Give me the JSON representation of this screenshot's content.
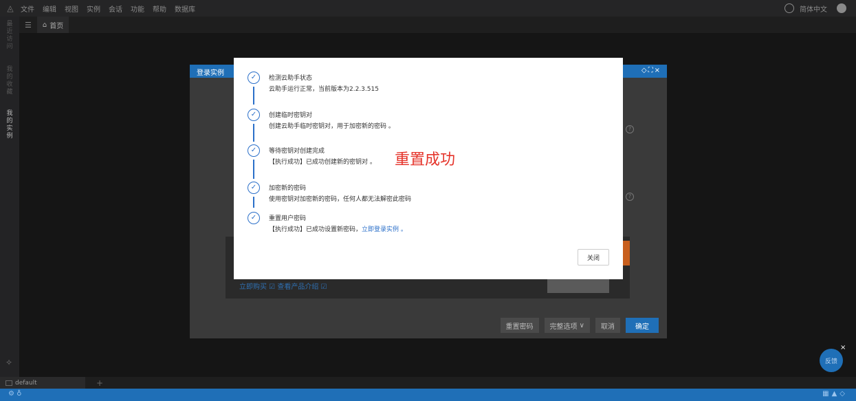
{
  "menubar": {
    "items": [
      "文件",
      "编辑",
      "视图",
      "实例",
      "会话",
      "功能",
      "帮助",
      "数据库"
    ],
    "language": "简体中文"
  },
  "sidebar": {
    "groups": [
      "最近访问",
      "我的收藏",
      "我的实例"
    ]
  },
  "tabs": {
    "home": "首页"
  },
  "background_dialog": {
    "title": "登录实例",
    "links": "立即购买 ☑  查看产品介绍 ☑",
    "buttons": {
      "reset_password": "重置密码",
      "full_options": "完整选项",
      "cancel": "取消",
      "confirm": "确定"
    }
  },
  "modal": {
    "steps": [
      {
        "title": "检测云助手状态",
        "desc": "云助手运行正常，当前版本为2.2.3.515"
      },
      {
        "title": "创建临时密钥对",
        "desc": "创建云助手临时密钥对，用于加密新的密码 。"
      },
      {
        "title": "等待密钥对创建完成",
        "desc": "【执行成功】已成功创建新的密钥对 。"
      },
      {
        "title": "加密新的密码",
        "desc": "使用密钥对加密新的密码，任何人都无法解密此密码"
      },
      {
        "title": "重置用户密码",
        "desc": "【执行成功】已成功设置新密码，",
        "link": "立即登录实例",
        "link_suffix": " 。"
      }
    ],
    "success_text": "重置成功",
    "close_label": "关闭"
  },
  "bottom": {
    "session_tab": "default"
  },
  "feedback_label": "反馈",
  "colors": {
    "accent": "#1f6fb7",
    "check": "#2a6fc9",
    "success_text": "#e5332a"
  }
}
